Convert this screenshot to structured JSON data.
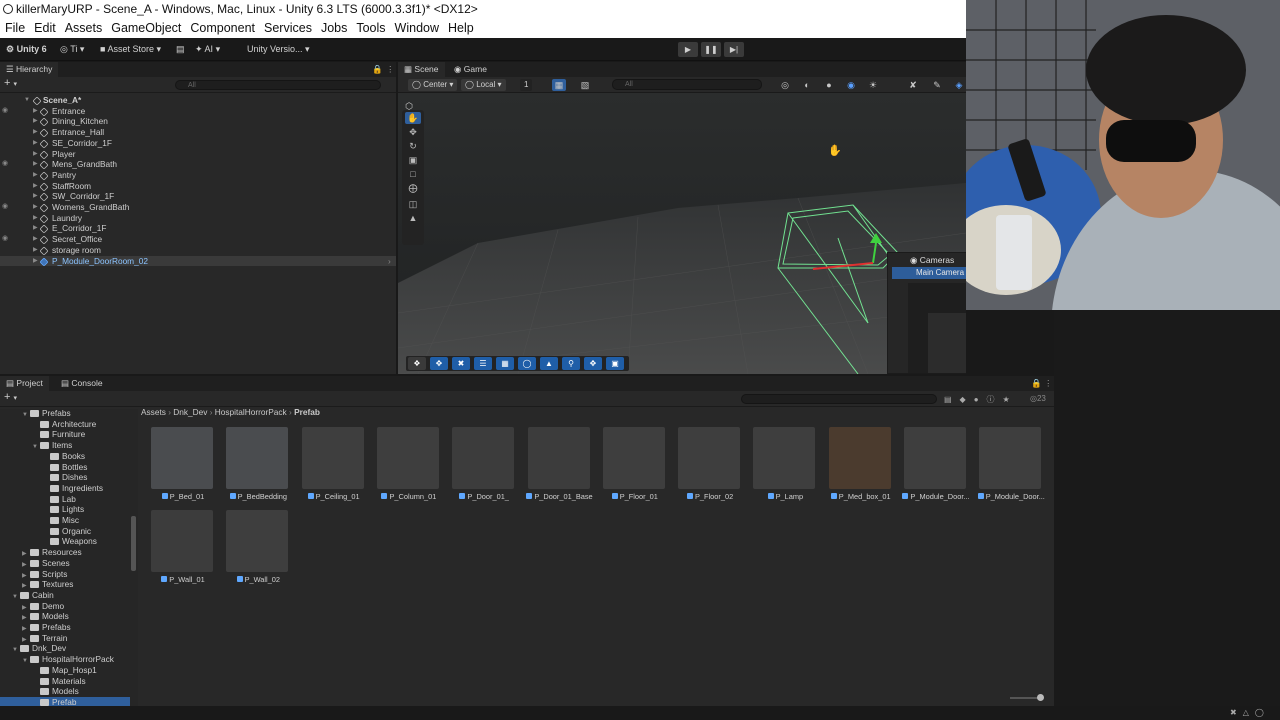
{
  "window": {
    "title": "killerMaryURP - Scene_A - Windows, Mac, Linux - Unity 6.3 LTS (6000.3.3f1)* <DX12>"
  },
  "menu": [
    "File",
    "Edit",
    "Assets",
    "GameObject",
    "Component",
    "Services",
    "Jobs",
    "Tools",
    "Window",
    "Help"
  ],
  "toolbar": {
    "account": "Unity 6",
    "cloud": "Ti",
    "asset_store": "Asset Store",
    "ai": "AI",
    "version_control": "Unity Versio..."
  },
  "hierarchy": {
    "tab": "Hierarchy",
    "search_placeholder": "All",
    "scene": "Scene_A*",
    "items": [
      "Entrance",
      "Dining_Kitchen",
      "Entrance_Hall",
      "SE_Corridor_1F",
      "Player",
      "Mens_GrandBath",
      "Pantry",
      "StaffRoom",
      "SW_Corridor_1F",
      "Womens_GrandBath",
      "Laundry",
      "E_Corridor_1F",
      "Secret_Office",
      "storage room",
      "P_Module_DoorRoom_02"
    ]
  },
  "scene": {
    "tabs": [
      "Scene",
      "Game"
    ],
    "pivot": "Center",
    "space": "Local",
    "snap_value": "1",
    "search_placeholder": "All",
    "cameras_label": "Cameras",
    "main_camera": "Main Camera"
  },
  "project": {
    "tabs": [
      "Project",
      "Console"
    ],
    "item_count": "23",
    "breadcrumb": [
      "Assets",
      "Dnk_Dev",
      "HospitalHorrorPack",
      "Prefab"
    ],
    "tree": [
      {
        "label": "Prefabs",
        "depth": 1,
        "expanded": true
      },
      {
        "label": "Architecture",
        "depth": 2
      },
      {
        "label": "Furniture",
        "depth": 2
      },
      {
        "label": "Items",
        "depth": 2,
        "expanded": true
      },
      {
        "label": "Books",
        "depth": 3
      },
      {
        "label": "Bottles",
        "depth": 3
      },
      {
        "label": "Dishes",
        "depth": 3
      },
      {
        "label": "Ingredients",
        "depth": 3
      },
      {
        "label": "Lab",
        "depth": 3
      },
      {
        "label": "Lights",
        "depth": 3
      },
      {
        "label": "Misc",
        "depth": 3
      },
      {
        "label": "Organic",
        "depth": 3
      },
      {
        "label": "Weapons",
        "depth": 3
      },
      {
        "label": "Resources",
        "depth": 1
      },
      {
        "label": "Scenes",
        "depth": 1
      },
      {
        "label": "Scripts",
        "depth": 1
      },
      {
        "label": "Textures",
        "depth": 1
      },
      {
        "label": "Cabin",
        "depth": 0,
        "expanded": true
      },
      {
        "label": "Demo",
        "depth": 1
      },
      {
        "label": "Models",
        "depth": 1
      },
      {
        "label": "Prefabs",
        "depth": 1
      },
      {
        "label": "Terrain",
        "depth": 1
      },
      {
        "label": "Dnk_Dev",
        "depth": 0,
        "expanded": true
      },
      {
        "label": "HospitalHorrorPack",
        "depth": 1,
        "expanded": true
      },
      {
        "label": "Map_Hosp1",
        "depth": 2
      },
      {
        "label": "Materials",
        "depth": 2
      },
      {
        "label": "Models",
        "depth": 2
      },
      {
        "label": "Prefab",
        "depth": 2,
        "selected": true
      }
    ],
    "assets": [
      "P_Bed_01",
      "P_BedBedding",
      "P_Ceiling_01",
      "P_Column_01",
      "P_Door_01_",
      "P_Door_01_Base",
      "P_Floor_01",
      "P_Floor_02",
      "P_Lamp",
      "P_Med_box_01",
      "P_Module_Door...",
      "P_Module_Door...",
      "P_Wall_01",
      "P_Wall_02"
    ]
  },
  "colors": {
    "accent": "#2f6fc0",
    "prefab_blue": "#5fa8ff",
    "panel": "#282828"
  }
}
